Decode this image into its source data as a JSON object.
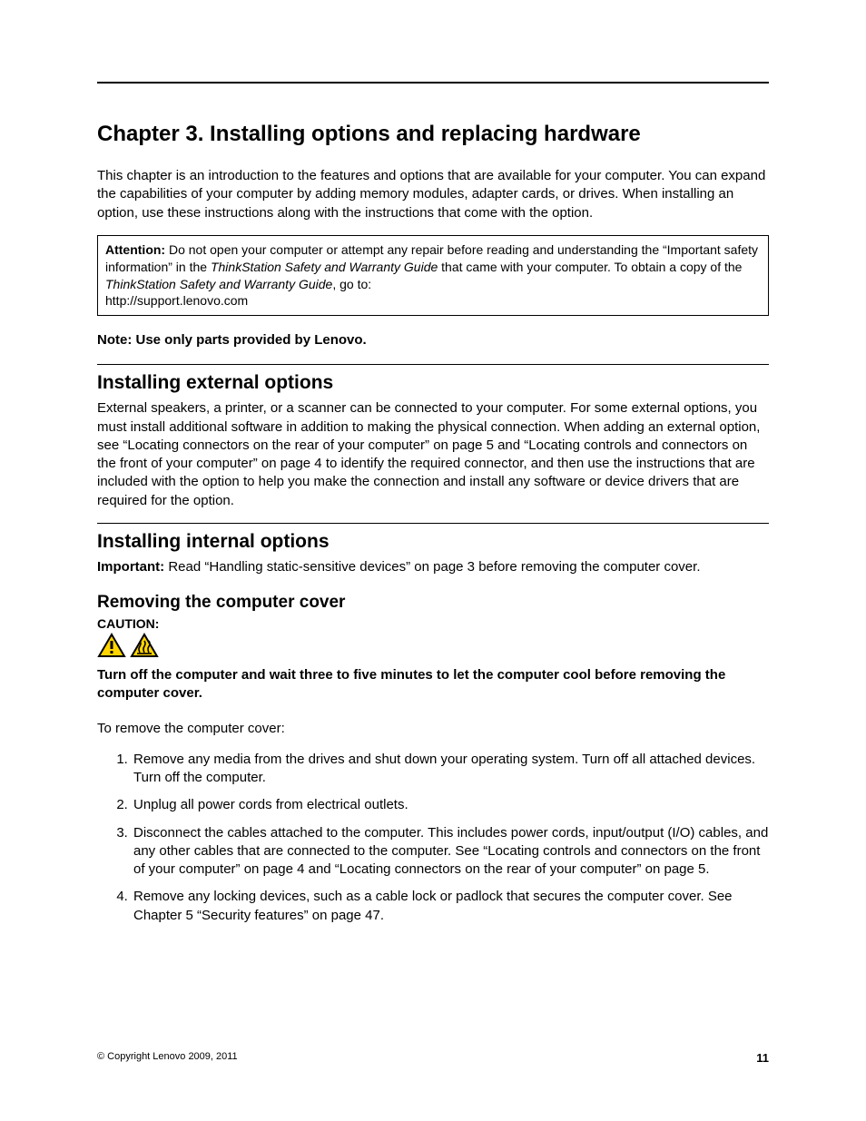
{
  "chapter_title": "Chapter 3.   Installing options and replacing hardware",
  "intro_paragraph": "This chapter is an introduction to the features and options that are available for your computer. You can expand the capabilities of your computer by adding memory modules, adapter cards, or drives. When installing an option, use these instructions along with the instructions that come with the option.",
  "attention": {
    "label": "Attention:",
    "text_before_italic": " Do not open your computer or attempt any repair before reading and understanding the “Important safety information” in the ",
    "italic1": "ThinkStation Safety and Warranty Guide",
    "text_mid": " that came with your computer. To obtain a copy of the ",
    "italic2": "ThinkStation Safety and Warranty Guide",
    "text_after": ", go to:",
    "url": "http://support.lenovo.com"
  },
  "note_text": "Note: Use only parts provided by Lenovo.",
  "section_external": {
    "heading": "Installing external options",
    "body": "External speakers, a printer, or a scanner can be connected to your computer. For some external options, you must install additional software in addition to making the physical connection. When adding an external option, see “Locating connectors on the rear of your computer” on page 5 and “Locating controls and connectors on the front of your computer” on page 4 to identify the required connector, and then use the instructions that are included with the option to help you make the connection and install any software or device drivers that are required for the option."
  },
  "section_internal": {
    "heading": "Installing internal options",
    "important_label": "Important:",
    "important_text": " Read “Handling static-sensitive devices” on page 3 before removing the computer cover."
  },
  "section_cover": {
    "heading": "Removing the computer cover",
    "caution_label": "CAUTION:",
    "caution_text": "Turn off the computer and wait three to five minutes to let the computer cool before removing the computer cover.",
    "intro": "To remove the computer cover:",
    "steps": [
      "Remove any media from the drives and shut down your operating system. Turn off all attached devices. Turn off the computer.",
      "Unplug all power cords from electrical outlets.",
      "Disconnect the cables attached to the computer. This includes power cords, input/output (I/O) cables, and any other cables that are connected to the computer. See “Locating controls and connectors on the front of your computer” on page 4 and “Locating connectors on the rear of your computer” on page 5.",
      "Remove any locking devices, such as a cable lock or padlock that secures the computer cover. See Chapter 5 “Security features” on page 47."
    ]
  },
  "footer": {
    "copyright": "© Copyright Lenovo 2009, 2011",
    "page_number": "11"
  }
}
